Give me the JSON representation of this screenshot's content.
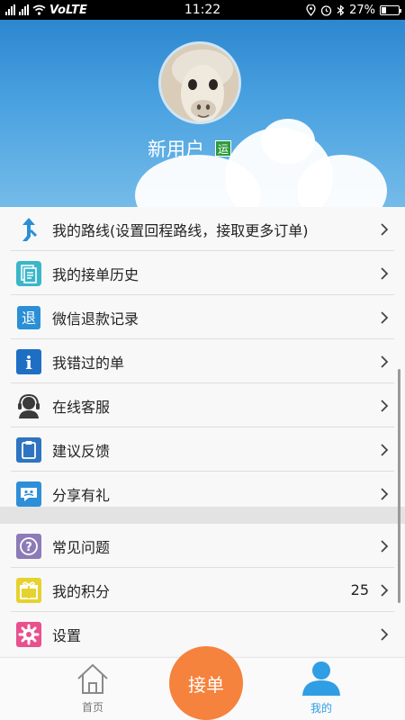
{
  "status_bar": {
    "network_label": "VoLTE",
    "time": "11:22",
    "battery_percent": "27%",
    "battery_level": 0.27
  },
  "profile": {
    "username": "新用户",
    "badge": "运"
  },
  "menu_top": [
    {
      "label": "我的路线(设置回程路线，接取更多订单)",
      "icon": "route-arrow-icon"
    },
    {
      "label": "我的接单历史",
      "icon": "order-history-icon"
    },
    {
      "label": "微信退款记录",
      "icon": "refund-icon"
    },
    {
      "label": "我错过的单",
      "icon": "info-icon"
    },
    {
      "label": "在线客服",
      "icon": "customer-service-icon"
    },
    {
      "label": "建议反馈",
      "icon": "clipboard-icon"
    },
    {
      "label": "分享有礼",
      "icon": "share-chat-icon"
    }
  ],
  "menu_bottom": [
    {
      "label": "常见问题",
      "icon": "question-icon"
    },
    {
      "label": "我的积分",
      "icon": "gift-icon",
      "value": "25"
    },
    {
      "label": "设置",
      "icon": "gear-icon"
    }
  ],
  "bottom_nav": {
    "home_label": "首页",
    "center_label": "接单",
    "me_label": "我的"
  },
  "icons": {
    "refund_glyph": "退",
    "info_glyph": "i",
    "question_glyph": "?"
  },
  "colors": {
    "accent_orange": "#f5823d",
    "accent_blue": "#2f9ee4",
    "header_blue": "#2d87cf"
  }
}
